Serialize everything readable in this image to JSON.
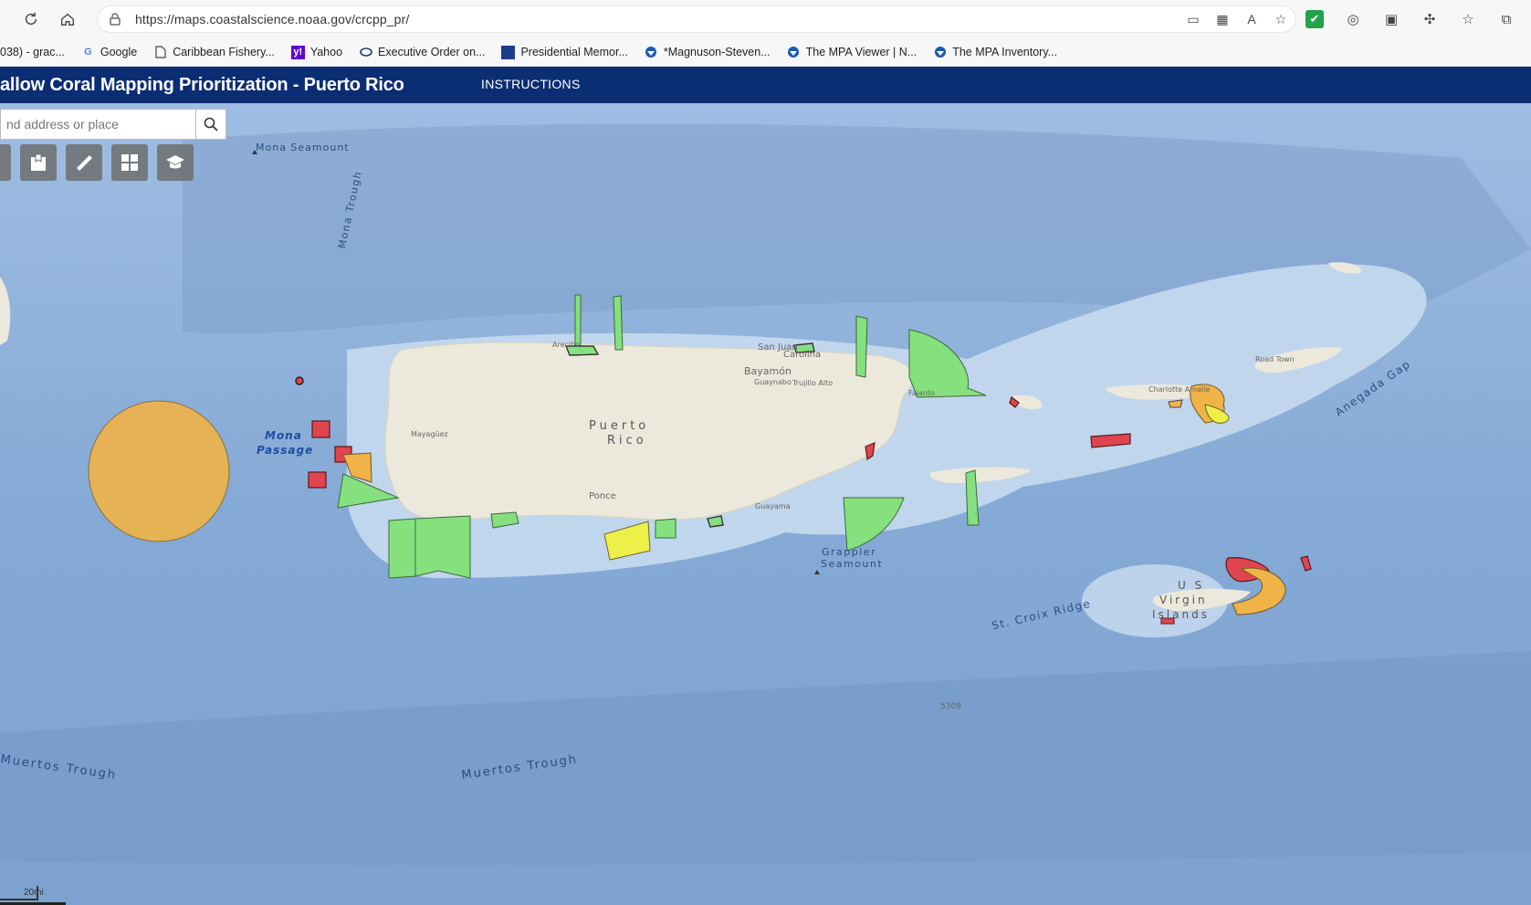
{
  "browser": {
    "url": "https://maps.coastalscience.noaa.gov/crcpp_pr/",
    "bookmarks": [
      {
        "label": "038) - grac...",
        "icon": "page-icon"
      },
      {
        "label": "Google",
        "icon": "google-icon"
      },
      {
        "label": "Caribbean Fishery...",
        "icon": "page-icon"
      },
      {
        "label": "Yahoo",
        "icon": "yahoo-icon"
      },
      {
        "label": "Executive Order on...",
        "icon": "seal-icon"
      },
      {
        "label": "Presidential Memor...",
        "icon": "building-icon"
      },
      {
        "label": "*Magnuson-Steven...",
        "icon": "noaa-icon"
      },
      {
        "label": "The MPA Viewer | N...",
        "icon": "noaa-icon"
      },
      {
        "label": "The MPA Inventory...",
        "icon": "noaa-icon"
      }
    ]
  },
  "app": {
    "title": "allow Coral Mapping Prioritization - Puerto Rico",
    "nav_link": "INSTRUCTIONS"
  },
  "search": {
    "placeholder": "nd address or place"
  },
  "map": {
    "labels": {
      "mona_seamount": "Mona Seamount",
      "mona_trough": "Mona Trough",
      "mona_passage_1": "Mona",
      "mona_passage_2": "Passage",
      "puerto": "Puerto",
      "rico": "Rico",
      "arecibo": "Arecibo",
      "san_juan": "San Juan",
      "carolina": "Carolina",
      "bayamon": "Bayamón",
      "guaynabo": "Guaynabo",
      "trujillo_alto": "Trujillo Alto",
      "fajardo": "Fajardo",
      "mayaguez": "Mayagüez",
      "ponce": "Ponce",
      "guayama": "Guayama",
      "grappler_1": "Grappler",
      "grappler_2": "Seamount",
      "road_town": "Road Town",
      "charlotte_amalie": "Charlotte Amalie",
      "anegada_gap": "Anegada Gap",
      "usvi_1": "U S",
      "usvi_2": "Virgin",
      "usvi_3": "Islands",
      "st_croix_ridge": "St. Croix Ridge",
      "depth_5309": "5309",
      "muertos_trough_left": "Muertos Trough",
      "muertos_trough_center": "Muertos Trough"
    },
    "scale_label": "20mi",
    "colors": {
      "green": "#86e07e",
      "red": "#e0454f",
      "orange": "#f0b347",
      "yellow": "#eef04a",
      "land": "#e9e6d6",
      "header": "#0a2d74"
    }
  }
}
